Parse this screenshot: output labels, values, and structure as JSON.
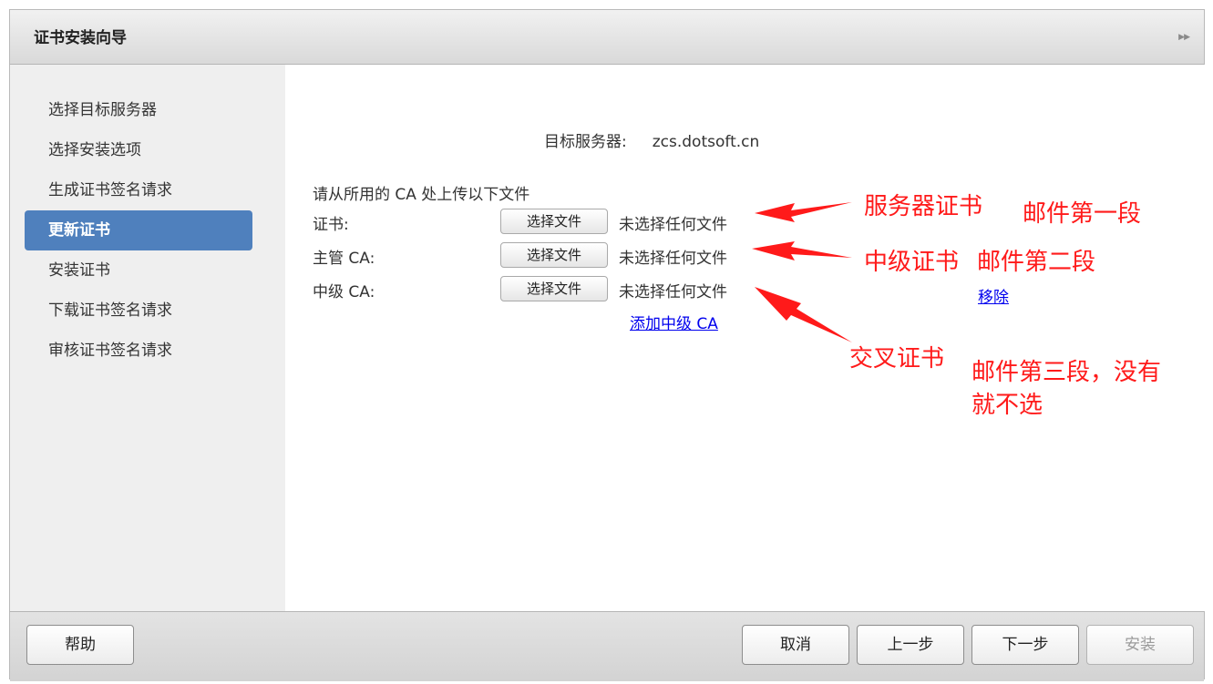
{
  "window": {
    "title": "证书安装向导"
  },
  "sidebar": {
    "items": [
      {
        "label": "选择目标服务器"
      },
      {
        "label": "选择安装选项"
      },
      {
        "label": "生成证书签名请求"
      },
      {
        "label": "更新证书",
        "active": true
      },
      {
        "label": "安装证书"
      },
      {
        "label": "下载证书签名请求"
      },
      {
        "label": "审核证书签名请求"
      }
    ]
  },
  "main": {
    "target_label": "目标服务器:",
    "target_value": "zcs.dotsoft.cn",
    "intro": "请从所用的 CA 处上传以下文件",
    "files": [
      {
        "label": "证书:",
        "button": "选择文件",
        "status": "未选择任何文件"
      },
      {
        "label": "主管 CA:",
        "button": "选择文件",
        "status": "未选择任何文件"
      },
      {
        "label": "中级 CA:",
        "button": "选择文件",
        "status": "未选择任何文件"
      }
    ],
    "remove_link": "移除",
    "add_link": "添加中级 CA"
  },
  "annotations": {
    "color": "#ff1a1a",
    "cert": "服务器证书",
    "cert_note": "邮件第一段",
    "intermediate": "中级证书",
    "intermediate_note": "邮件第二段",
    "cross": "交叉证书",
    "cross_note_1": "邮件第三段，没有",
    "cross_note_2": "就不选"
  },
  "footer": {
    "help": "帮助",
    "cancel": "取消",
    "prev": "上一步",
    "next": "下一步",
    "install": "安装"
  },
  "colors": {
    "active_item": "#4f80bd",
    "link": "#0000ee"
  }
}
